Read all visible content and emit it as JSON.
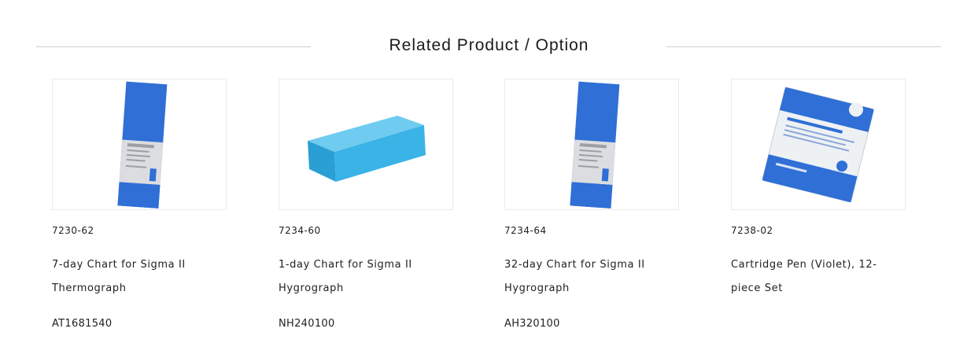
{
  "section": {
    "title": "Related Product / Option"
  },
  "products": [
    {
      "code": "7230-62",
      "name_lines": [
        "7-day Chart for Sigma II",
        "Thermograph"
      ],
      "sku": "AT1681540",
      "image": "chart-paper-roll-icon"
    },
    {
      "code": "7234-60",
      "name_lines": [
        "1-day Chart for Sigma II",
        "Hygrograph"
      ],
      "sku": "NH240100",
      "image": "blue-box-icon"
    },
    {
      "code": "7234-64",
      "name_lines": [
        "32-day Chart for Sigma II",
        "Hygrograph"
      ],
      "sku": "AH320100",
      "image": "chart-paper-roll-icon"
    },
    {
      "code": "7238-02",
      "name_lines": [
        "Cartridge Pen (Violet), 12-",
        "piece Set"
      ],
      "sku": "",
      "image": "pen-cartridge-pack-icon"
    }
  ],
  "colors": {
    "brand_blue": "#2f6fd6",
    "box_blue": "#3ab3e6",
    "rule": "#cfcfcf"
  }
}
